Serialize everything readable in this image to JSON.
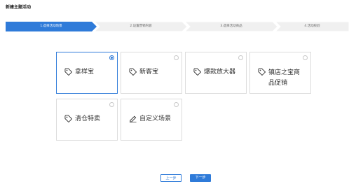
{
  "page": {
    "title": "新建主题活动"
  },
  "steps": [
    {
      "label": "1.选择活动场景",
      "active": true
    },
    {
      "label": "2.设置营销内容",
      "active": false
    },
    {
      "label": "3.选择活动商品",
      "active": false
    },
    {
      "label": "4.活动校验",
      "active": false
    }
  ],
  "colors": {
    "accent": "#2f7bd9",
    "step_inactive": "#f0f0f0",
    "border": "#dcdcdc"
  },
  "scenes": [
    {
      "label": "拿样宝",
      "icon": "tag-icon",
      "selected": true
    },
    {
      "label": "新客宝",
      "icon": "tag-icon",
      "selected": false
    },
    {
      "label": "爆款放大器",
      "icon": "tag-icon",
      "selected": false
    },
    {
      "label": "镇店之宝商品促销",
      "icon": "tag-icon",
      "selected": false
    },
    {
      "label": "清仓特卖",
      "icon": "tag-icon",
      "selected": false
    },
    {
      "label": "自定义场景",
      "icon": "edit-icon",
      "selected": false
    }
  ],
  "actions": {
    "prev_label": "上一步",
    "next_label": "下一步"
  }
}
